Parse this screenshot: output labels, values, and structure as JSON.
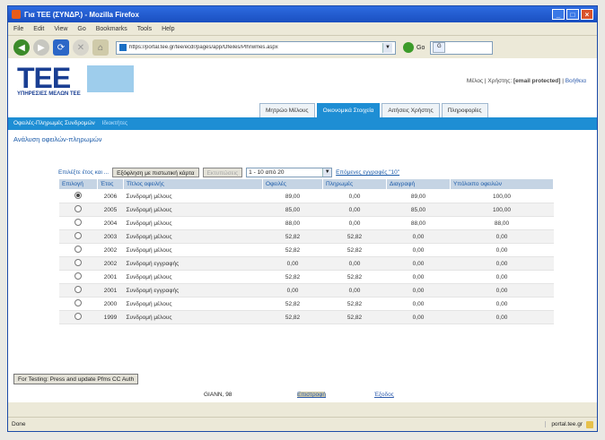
{
  "window": {
    "title": "Για ΤΕΕ (ΣΥΝΔΡ.) - Mozilla Firefox"
  },
  "menu": [
    "File",
    "Edit",
    "View",
    "Go",
    "Bookmarks",
    "Tools",
    "Help"
  ],
  "nav": {
    "url": "https://portal.tee.gr/tee/ecdr/pages/app/Ofeiles/Plhrwmes.aspx",
    "go_label": "Go",
    "search_placeholder": ""
  },
  "site": {
    "logo_text": "ΤΕΕ",
    "logo_sub": "ΥΠΗΡΕΣΙΕΣ ΜΕΛΩΝ ΤΕΕ",
    "user_prefix": "Μέλος | Χρήστης:",
    "user_email": "[email protected]",
    "user_sep": "|",
    "help_link": "Βοήθεια",
    "tabs": [
      "Μητρώο Μέλους",
      "Οικονομικά Στοιχεία",
      "Αιτήσεις Χρήστης",
      "Πληροφορίες"
    ],
    "bar_title": "Οφειλές-Πληρωμές Συνδρομών",
    "bar_sub": "Ιδιοκτήτες",
    "page_title": "Ανάλυση οφειλών-πληρωμών"
  },
  "controls": {
    "select_year_label": "Επιλέξτε έτος και ...",
    "print_button": "Εξόφληση με πιστωτική κάρτα",
    "disabled_button": "Εκτυπώσεις",
    "range_value": "1 - 10 από 20",
    "next_link": "Επόμενες εγγραφές \"10\""
  },
  "table": {
    "headers": [
      "Επιλογή",
      "Έτος",
      "Τίτλος οφειλής",
      "Οφειλές",
      "Πληρωμές",
      "Διαγραφή",
      "Υπόλοιπο οφειλών"
    ],
    "rows": [
      {
        "year": "2006",
        "title": "Συνδρομή μέλους",
        "debt": "89,00",
        "paid": "0,00",
        "deleted": "89,00",
        "balance": "100,00",
        "checked": true
      },
      {
        "year": "2005",
        "title": "Συνδρομή μέλους",
        "debt": "85,00",
        "paid": "0,00",
        "deleted": "85,00",
        "balance": "100,00",
        "checked": false
      },
      {
        "year": "2004",
        "title": "Συνδρομή μέλους",
        "debt": "88,00",
        "paid": "0,00",
        "deleted": "88,00",
        "balance": "88,00",
        "checked": false
      },
      {
        "year": "2003",
        "title": "Συνδρομή μέλους",
        "debt": "52,82",
        "paid": "52,82",
        "deleted": "0,00",
        "balance": "0,00",
        "checked": false
      },
      {
        "year": "2002",
        "title": "Συνδρομή μέλους",
        "debt": "52,82",
        "paid": "52,82",
        "deleted": "0,00",
        "balance": "0,00",
        "checked": false
      },
      {
        "year": "2002",
        "title": "Συνδρομή εγγραφής",
        "debt": "0,00",
        "paid": "0,00",
        "deleted": "0,00",
        "balance": "0,00",
        "checked": false
      },
      {
        "year": "2001",
        "title": "Συνδρομή μέλους",
        "debt": "52,82",
        "paid": "52,82",
        "deleted": "0,00",
        "balance": "0,00",
        "checked": false
      },
      {
        "year": "2001",
        "title": "Συνδρομή εγγραφής",
        "debt": "0,00",
        "paid": "0,00",
        "deleted": "0,00",
        "balance": "0,00",
        "checked": false
      },
      {
        "year": "2000",
        "title": "Συνδρομή μέλους",
        "debt": "52,82",
        "paid": "52,82",
        "deleted": "0,00",
        "balance": "0,00",
        "checked": false
      },
      {
        "year": "1999",
        "title": "Συνδρομή μέλους",
        "debt": "52,82",
        "paid": "52,82",
        "deleted": "0,00",
        "balance": "0,00",
        "checked": false
      }
    ]
  },
  "test_button": "For Testing: Press and update Pfms CC Auth",
  "footer": {
    "user": "GIANN, 98",
    "home": "Επιστροφή",
    "exit": "Έξοδος"
  },
  "status": {
    "text": "Done",
    "host": "portal.tee.gr"
  }
}
